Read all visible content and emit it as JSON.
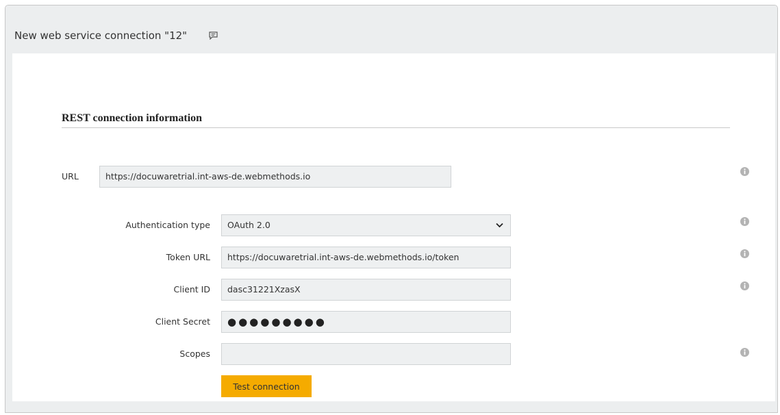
{
  "window": {
    "title": "New web service connection \"12\"",
    "title_icon": "comment-icon"
  },
  "section": {
    "title": "REST connection information"
  },
  "form": {
    "url": {
      "label": "URL",
      "value": "https://docuwaretrial.int-aws-de.webmethods.io"
    },
    "auth_type": {
      "label": "Authentication type",
      "selected": "OAuth 2.0"
    },
    "token_url": {
      "label": "Token URL",
      "value": "https://docuwaretrial.int-aws-de.webmethods.io/token"
    },
    "client_id": {
      "label": "Client ID",
      "value": "dasc31221XzasX"
    },
    "client_secret": {
      "label": "Client Secret",
      "masked_value": "●●●●●●●●●"
    },
    "scopes": {
      "label": "Scopes",
      "value": ""
    },
    "test_button_label": "Test connection"
  },
  "colors": {
    "accent": "#f5ab00",
    "field_bg": "#eef0f1",
    "info_icon": "#b3b3b3"
  }
}
